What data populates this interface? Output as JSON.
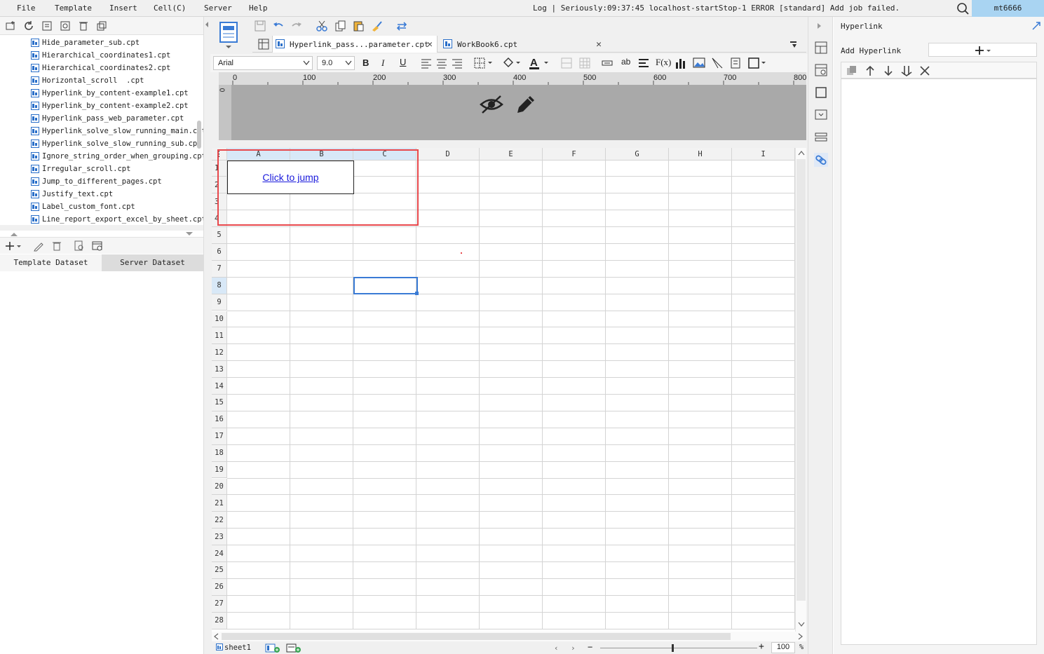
{
  "menubar": {
    "items": [
      "File",
      "Template",
      "Insert",
      "Cell(C)",
      "Server",
      "Help"
    ],
    "log_text": "Log | Seriously:09:37:45 localhost-startStop-1 ERROR [standard] Add job failed.",
    "username": "mt6666"
  },
  "file_list": [
    "Hide_parameter_sub.cpt",
    "Hierarchical_coordinates1.cpt",
    "Hierarchical_coordinates2.cpt",
    "Horizontal_scroll  .cpt",
    "Hyperlink_by_content-example1.cpt",
    "Hyperlink_by_content-example2.cpt",
    "Hyperlink_pass_web_parameter.cpt",
    "Hyperlink_solve_slow_running_main.cpt",
    "Hyperlink_solve_slow_running_sub.cpt",
    "Ignore_string_order_when_grouping.cpt",
    "Irregular_scroll.cpt",
    "Jump_to_different_pages.cpt",
    "Justify_text.cpt",
    "Label_custom_font.cpt",
    "Line_report_export_excel_by_sheet.cpt"
  ],
  "dataset_tabs": [
    "Template Dataset",
    "Server Dataset"
  ],
  "doc_tabs": [
    "Hyperlink_pass...parameter.cpt",
    "WorkBook6.cpt"
  ],
  "format_bar": {
    "font": "Arial",
    "size": "9.0"
  },
  "ruler_labels": [
    "0",
    "100",
    "200",
    "300",
    "400",
    "500",
    "600",
    "700",
    "800"
  ],
  "param_ruler_zero": "0",
  "columns": [
    "A",
    "B",
    "C",
    "D",
    "E",
    "F",
    "G",
    "H",
    "I"
  ],
  "rows": [
    "1",
    "2",
    "3",
    "4",
    "5",
    "6",
    "7",
    "8",
    "9",
    "10",
    "11",
    "12",
    "13",
    "14",
    "15",
    "16",
    "17",
    "18",
    "19",
    "20",
    "21",
    "22",
    "23",
    "24",
    "25",
    "26",
    "27",
    "28"
  ],
  "cell_link_text": "Click to jump",
  "sheet_tab": "sheet1",
  "zoom": {
    "value": "100",
    "unit": "%"
  },
  "right_panel": {
    "title": "Hyperlink",
    "add_label": "Add Hyperlink"
  },
  "colors": {
    "accent": "#3a7bd5",
    "highlight": "#e8484c",
    "user_bg": "#a9d4f2",
    "link": "#1a1adc"
  },
  "icons": {
    "search": "search-icon",
    "hide_param": "eye-off-icon",
    "edit_param": "pencil-icon",
    "hyperlink": "link-icon"
  }
}
